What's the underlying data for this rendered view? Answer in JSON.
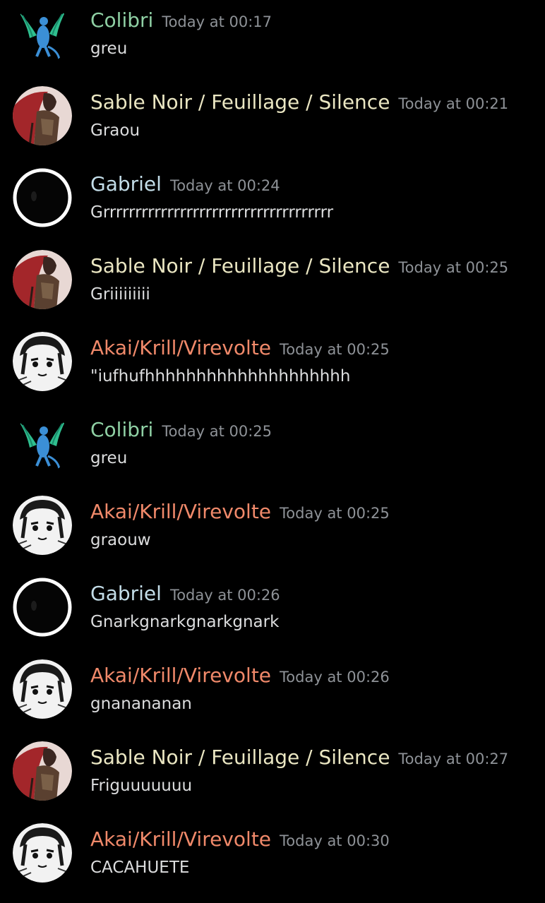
{
  "colors": {
    "background": "#000000",
    "colibri": "#8fd0a4",
    "sable": "#eae6c2",
    "gabriel": "#c3dde8",
    "akai": "#f0896a",
    "timestamp": "#8e9297",
    "message_text": "#dcddde"
  },
  "messages": [
    {
      "author": "Colibri",
      "time": "Today at 00:17",
      "text": "greu",
      "avatar": "dragon-avatar-icon"
    },
    {
      "author": "Sable Noir / Feuillage / Silence",
      "time": "Today at 00:21",
      "text": "Graou",
      "avatar": "warrior-avatar-icon"
    },
    {
      "author": "Gabriel",
      "time": "Today at 00:24",
      "text": "Grrrrrrrrrrrrrrrrrrrrrrrrrrrrrrrrrrrr",
      "avatar": "black-circle-avatar-icon"
    },
    {
      "author": "Sable Noir / Feuillage / Silence",
      "time": "Today at 00:25",
      "text": "Griiiiiiiii",
      "avatar": "warrior-avatar-icon"
    },
    {
      "author": "Akai/Krill/Virevolte",
      "time": "Today at 00:25",
      "text": "\"iufhufhhhhhhhhhhhhhhhhhhhh",
      "avatar": "manga-avatar-icon"
    },
    {
      "author": "Colibri",
      "time": "Today at 00:25",
      "text": "greu",
      "avatar": "dragon-avatar-icon"
    },
    {
      "author": "Akai/Krill/Virevolte",
      "time": "Today at 00:25",
      "text": "graouw",
      "avatar": "manga-avatar-icon"
    },
    {
      "author": "Gabriel",
      "time": "Today at 00:26",
      "text": "Gnarkgnarkgnarkgnark",
      "avatar": "black-circle-avatar-icon"
    },
    {
      "author": "Akai/Krill/Virevolte",
      "time": "Today at 00:26",
      "text": "gnanananan",
      "avatar": "manga-avatar-icon"
    },
    {
      "author": "Sable Noir / Feuillage / Silence",
      "time": "Today at 00:27",
      "text": "Friguuuuuuu",
      "avatar": "warrior-avatar-icon"
    },
    {
      "author": "Akai/Krill/Virevolte",
      "time": "Today at 00:30",
      "text": "CACAHUETE",
      "avatar": "manga-avatar-icon"
    }
  ]
}
